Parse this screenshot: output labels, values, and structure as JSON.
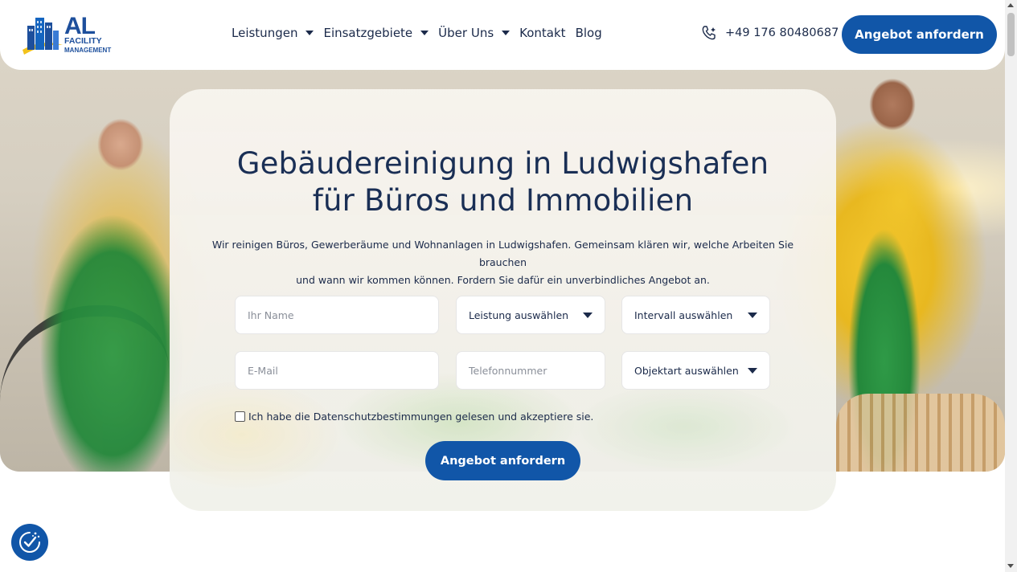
{
  "header": {
    "logo": {
      "line1": "AL",
      "line2": "FACILITY",
      "line3": "MANAGEMENT"
    },
    "nav": [
      {
        "label": "Leistungen",
        "has_dropdown": true
      },
      {
        "label": "Einsatzgebiete",
        "has_dropdown": true
      },
      {
        "label": "Über Uns",
        "has_dropdown": true
      },
      {
        "label": "Kontakt",
        "has_dropdown": false
      },
      {
        "label": "Blog",
        "has_dropdown": false
      }
    ],
    "phone": "+49 176 80480687",
    "cta_label": "Angebot anfordern"
  },
  "hero": {
    "title_line1": "Gebäudereinigung in Ludwigshafen",
    "title_line2": "für Büros und Immobilien",
    "intro_line1": "Wir reinigen Büros, Gewerberäume und Wohnanlagen in Ludwigshafen. Gemeinsam klären wir, welche Arbeiten Sie brauchen",
    "intro_line2": "und wann wir kommen können. Fordern Sie dafür ein unverbindliches Angebot an."
  },
  "form": {
    "name_placeholder": "Ihr Name",
    "service_select": "Leistung auswählen",
    "interval_select": "Intervall auswählen",
    "email_placeholder": "E-Mail",
    "phone_placeholder": "Telefonnummer",
    "object_select": "Objektart auswählen",
    "consent_label": "Ich habe die Datenschutzbestimmungen gelesen und akzeptiere sie.",
    "consent_checked": false,
    "submit_label": "Angebot anfordern"
  },
  "colors": {
    "brand_blue": "#1156a8",
    "heading_navy": "#1a2f55",
    "text_dark": "#1b2a4a"
  }
}
